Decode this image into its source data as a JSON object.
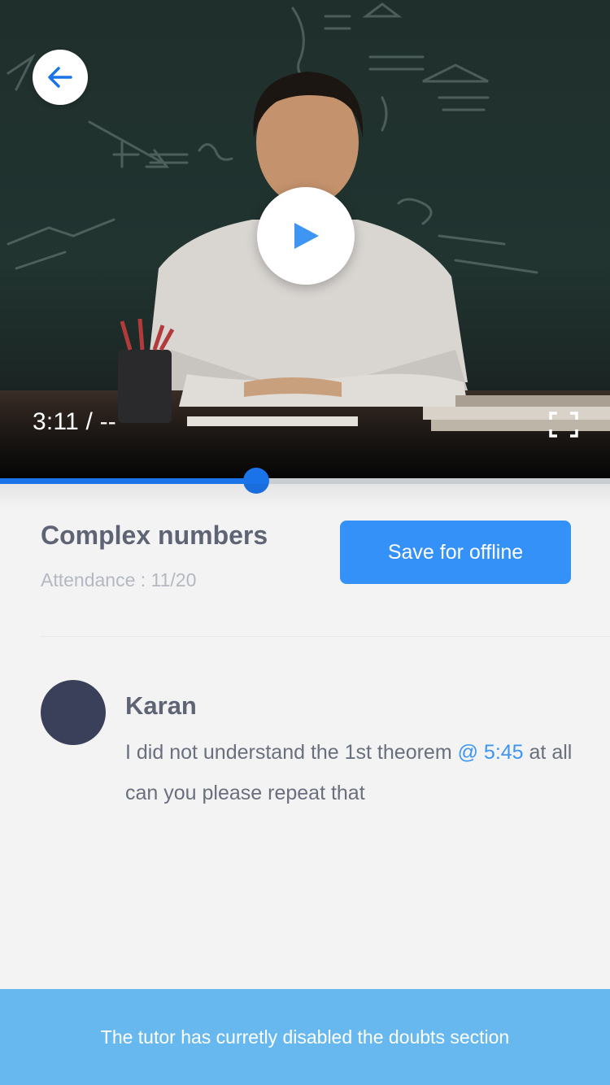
{
  "video": {
    "current_time": "3:11 / --",
    "progress_fraction": 0.42
  },
  "icons": {
    "back": "arrow-left-icon",
    "play": "play-icon",
    "fullscreen": "fullscreen-icon"
  },
  "lesson": {
    "title": "Complex numbers",
    "attendance": "Attendance : 11/20",
    "save_label": "Save for offline"
  },
  "comment": {
    "author": "Karan",
    "text_before": "I did not understand the 1st theorem ",
    "timestamp": "@ 5:45",
    "text_after": " at all can you please repeat that"
  },
  "banner": {
    "message": "The tutor has curretly disabled the doubts section"
  },
  "colors": {
    "accent": "#3391f7",
    "progress": "#1a73e8",
    "link": "#3e95f2",
    "banner": "#66b8ef",
    "avatar": "#3a4059"
  }
}
